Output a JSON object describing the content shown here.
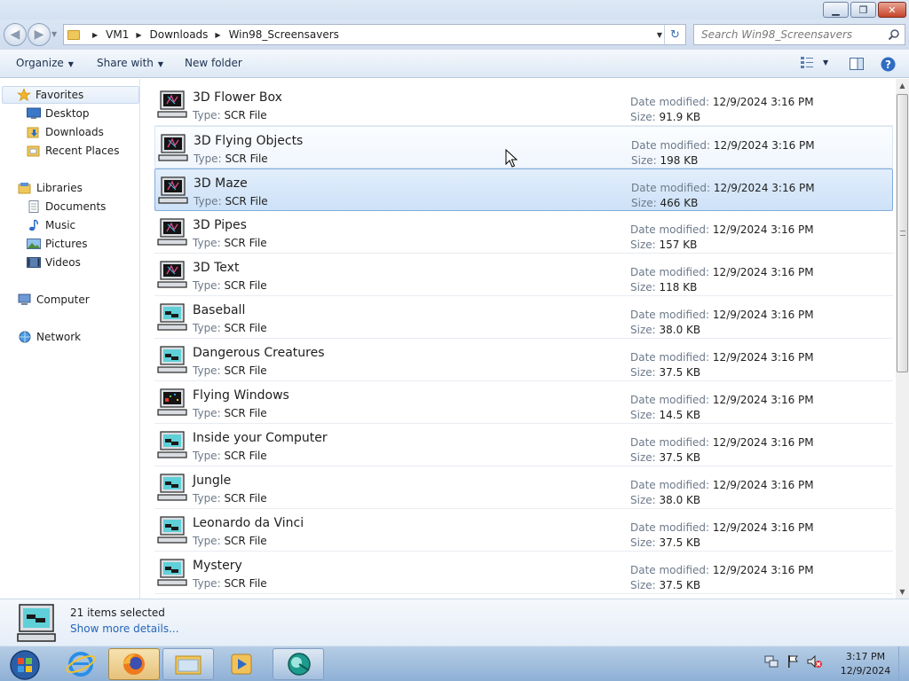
{
  "address": {
    "crumbs": [
      "VM1",
      "Downloads",
      "Win98_Screensavers"
    ],
    "search_placeholder": "Search Win98_Screensavers"
  },
  "toolbar": {
    "organize": "Organize",
    "share_with": "Share with",
    "new_folder": "New folder"
  },
  "nav": {
    "favorites": "Favorites",
    "desktop": "Desktop",
    "downloads": "Downloads",
    "recent_places": "Recent Places",
    "libraries": "Libraries",
    "documents": "Documents",
    "music": "Music",
    "pictures": "Pictures",
    "videos": "Videos",
    "computer": "Computer",
    "network": "Network"
  },
  "labels": {
    "type": "Type:",
    "date_modified": "Date modified:",
    "size": "Size:"
  },
  "files": [
    {
      "name": "3D Flower Box",
      "type": "SCR File",
      "date": "12/9/2024 3:16 PM",
      "size": "91.9 KB",
      "icon": "screensaver-dark-icon",
      "state": "normal"
    },
    {
      "name": "3D Flying Objects",
      "type": "SCR File",
      "date": "12/9/2024 3:16 PM",
      "size": "198 KB",
      "icon": "screensaver-dark-icon",
      "state": "hover"
    },
    {
      "name": "3D Maze",
      "type": "SCR File",
      "date": "12/9/2024 3:16 PM",
      "size": "466 KB",
      "icon": "screensaver-dark-icon",
      "state": "selected"
    },
    {
      "name": "3D Pipes",
      "type": "SCR File",
      "date": "12/9/2024 3:16 PM",
      "size": "157 KB",
      "icon": "screensaver-dark-icon",
      "state": "normal"
    },
    {
      "name": "3D Text",
      "type": "SCR File",
      "date": "12/9/2024 3:16 PM",
      "size": "118 KB",
      "icon": "screensaver-dark-icon",
      "state": "normal"
    },
    {
      "name": "Baseball",
      "type": "SCR File",
      "date": "12/9/2024 3:16 PM",
      "size": "38.0 KB",
      "icon": "screensaver-cyan-icon",
      "state": "normal"
    },
    {
      "name": "Dangerous Creatures",
      "type": "SCR File",
      "date": "12/9/2024 3:16 PM",
      "size": "37.5 KB",
      "icon": "screensaver-cyan-icon",
      "state": "normal"
    },
    {
      "name": "Flying Windows",
      "type": "SCR File",
      "date": "12/9/2024 3:16 PM",
      "size": "14.5 KB",
      "icon": "screensaver-windows-icon",
      "state": "normal"
    },
    {
      "name": "Inside your Computer",
      "type": "SCR File",
      "date": "12/9/2024 3:16 PM",
      "size": "37.5 KB",
      "icon": "screensaver-cyan-icon",
      "state": "normal"
    },
    {
      "name": "Jungle",
      "type": "SCR File",
      "date": "12/9/2024 3:16 PM",
      "size": "38.0 KB",
      "icon": "screensaver-cyan-icon",
      "state": "normal"
    },
    {
      "name": "Leonardo da Vinci",
      "type": "SCR File",
      "date": "12/9/2024 3:16 PM",
      "size": "37.5 KB",
      "icon": "screensaver-cyan-icon",
      "state": "normal"
    },
    {
      "name": "Mystery",
      "type": "SCR File",
      "date": "12/9/2024 3:16 PM",
      "size": "37.5 KB",
      "icon": "screensaver-cyan-icon",
      "state": "normal"
    }
  ],
  "details": {
    "count": "21 items selected",
    "more": "Show more details..."
  },
  "clock": {
    "time": "3:17 PM",
    "date": "12/9/2024"
  },
  "colors": {
    "selected_bg": "#cde1f8",
    "accent_link": "#2465b7",
    "taskbar": "#9fbbdd"
  }
}
